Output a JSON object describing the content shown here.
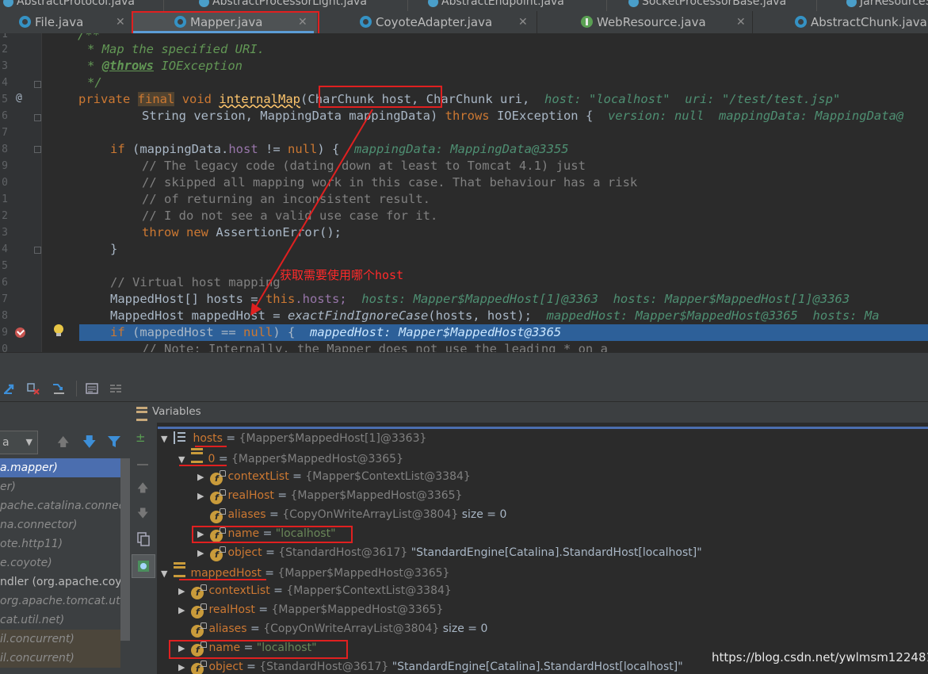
{
  "top_tabs": [
    {
      "label": "AbstractProtocol.java"
    },
    {
      "label": "AbstractProcessorLight.java"
    },
    {
      "label": "AbstractEndpoint.java"
    },
    {
      "label": "SocketProcessorBase.java"
    },
    {
      "label": "JarResourceS"
    }
  ],
  "tabs": [
    {
      "label": "File.java",
      "icon": "class-icon"
    },
    {
      "label": "Mapper.java",
      "icon": "class-icon",
      "active": true
    },
    {
      "label": "CoyoteAdapter.java",
      "icon": "class-icon"
    },
    {
      "label": "WebResource.java",
      "icon": "interface-icon"
    },
    {
      "label": "AbstractChunk.java",
      "icon": "class-icon"
    }
  ],
  "editor": {
    "line_numbers": [
      "1",
      "2",
      "3",
      "4",
      "5",
      "6",
      "7",
      "8",
      "9",
      "0",
      "1",
      "2",
      "3",
      "4",
      "5",
      "6",
      "7",
      "8",
      "9",
      "0"
    ],
    "doc_open": "/**",
    "doc_line1": "* Map the specified URI.",
    "doc_star": "*",
    "doc_throws_tag": "@throws",
    "doc_throws_type": "IOException",
    "doc_close": "*/",
    "kw_private": "private",
    "kw_final": "final",
    "kw_void": "void",
    "method_name": "internalMap",
    "param1": "CharChunk host",
    "param2": ", CharChunk uri,",
    "hint_host_uri": "host: \"localhost\"  uri: \"/test/test.jsp\"",
    "line2_a": "String version, MappingData mappingData)",
    "kw_throws": "throws",
    "line2_b": "IOException {",
    "hint_version": "version: null  mappingData: MappingData@",
    "if_open": "if",
    "if_cond_a": " (mappingData.",
    "if_field": "host",
    "if_cond_b": " != ",
    "kw_null": "null",
    "if_cond_c": ") {",
    "hint_mapping": "mappingData: MappingData@3355",
    "comment1": "// The legacy code (dating down at least to Tomcat 4.1) just",
    "comment2": "// skipped all mapping work in this case. That behaviour has a risk",
    "comment3": "// of returning an inconsistent result.",
    "comment4": "// I do not see a valid use case for it.",
    "kw_throw": "throw",
    "kw_new": "new",
    "throw_rest": "AssertionError();",
    "close_brace": "}",
    "comment_virtual": "// Virtual host mapping",
    "hosts_decl_a": "MappedHost[] hosts = ",
    "kw_this": "this",
    "hosts_field": ".hosts;",
    "hint_hosts": "hosts: Mapper$MappedHost[1]@3363  hosts: Mapper$MappedHost[1]@3363",
    "mapped_decl_a": "MappedHost mappedHost = ",
    "mapped_call": "exactFindIgnoreCase",
    "mapped_args": "(hosts, host);",
    "hint_mapped": "mappedHost: Mapper$MappedHost@3365  hosts: Ma",
    "if2_a": " (mappedHost == ",
    "if2_b": ") {",
    "hint_if2": "mappedHost: Mapper$MappedHost@3365",
    "note_partial": "// Note: Internally, the Mapper does not use the leading * on a"
  },
  "annotation_text": "获取需要使用哪个host",
  "variables_panel": {
    "title": "Variables"
  },
  "frames": {
    "selector_label": "a",
    "items": [
      {
        "text": "a.mapper)",
        "selected": true
      },
      {
        "text": "er)"
      },
      {
        "text": "pache.catalina.connector)"
      },
      {
        "text": "na.connector)"
      },
      {
        "text": "ote.http11)"
      },
      {
        "text": "e.coyote)"
      },
      {
        "text": "ndler (org.apache.coyote"
      },
      {
        "text": "org.apache.tomcat.util.ne"
      },
      {
        "text": "cat.util.net)"
      },
      {
        "text": "il.concurrent)",
        "lib": true
      },
      {
        "text": "il.concurrent)",
        "lib": true
      }
    ]
  },
  "variables": [
    {
      "name": "hosts",
      "type": "{Mapper$MappedHost[1]@3363}",
      "extra": "",
      "icon": "list"
    },
    {
      "name": "0",
      "type": "{Mapper$MappedHost@3365}",
      "extra": "",
      "icon": "array"
    },
    {
      "name": "contextList",
      "type": "{Mapper$ContextList@3384}",
      "extra": "",
      "icon": "field"
    },
    {
      "name": "realHost",
      "type": "{Mapper$MappedHost@3365}",
      "extra": "",
      "icon": "field"
    },
    {
      "name": "aliases",
      "type": "{CopyOnWriteArrayList@3804}",
      "extra": "size = 0",
      "icon": "field"
    },
    {
      "name": "name",
      "type": "",
      "str": "\"localhost\"",
      "icon": "field"
    },
    {
      "name": "object",
      "type": "{StandardHost@3617}",
      "extra": "\"StandardEngine[Catalina].StandardHost[localhost]\"",
      "icon": "field"
    },
    {
      "name": "mappedHost",
      "type": "{Mapper$MappedHost@3365}",
      "extra": "",
      "icon": "array"
    },
    {
      "name": "contextList",
      "type": "{Mapper$ContextList@3384}",
      "extra": "",
      "icon": "field"
    },
    {
      "name": "realHost",
      "type": "{Mapper$MappedHost@3365}",
      "extra": "",
      "icon": "field"
    },
    {
      "name": "aliases",
      "type": "{CopyOnWriteArrayList@3804}",
      "extra": "size = 0",
      "icon": "field"
    },
    {
      "name": "name",
      "type": "",
      "str": "\"localhost\"",
      "icon": "field"
    },
    {
      "name": "object",
      "type": "{StandardHost@3617}",
      "extra": "\"StandardEngine[Catalina].StandardHost[localhost]\"",
      "icon": "field"
    }
  ],
  "watermark": "https://blog.csdn.net/ywlmsm1224811",
  "colors": {
    "annotation": "#e02020",
    "selection": "#2d6099",
    "accent": "#4b6eaf"
  }
}
